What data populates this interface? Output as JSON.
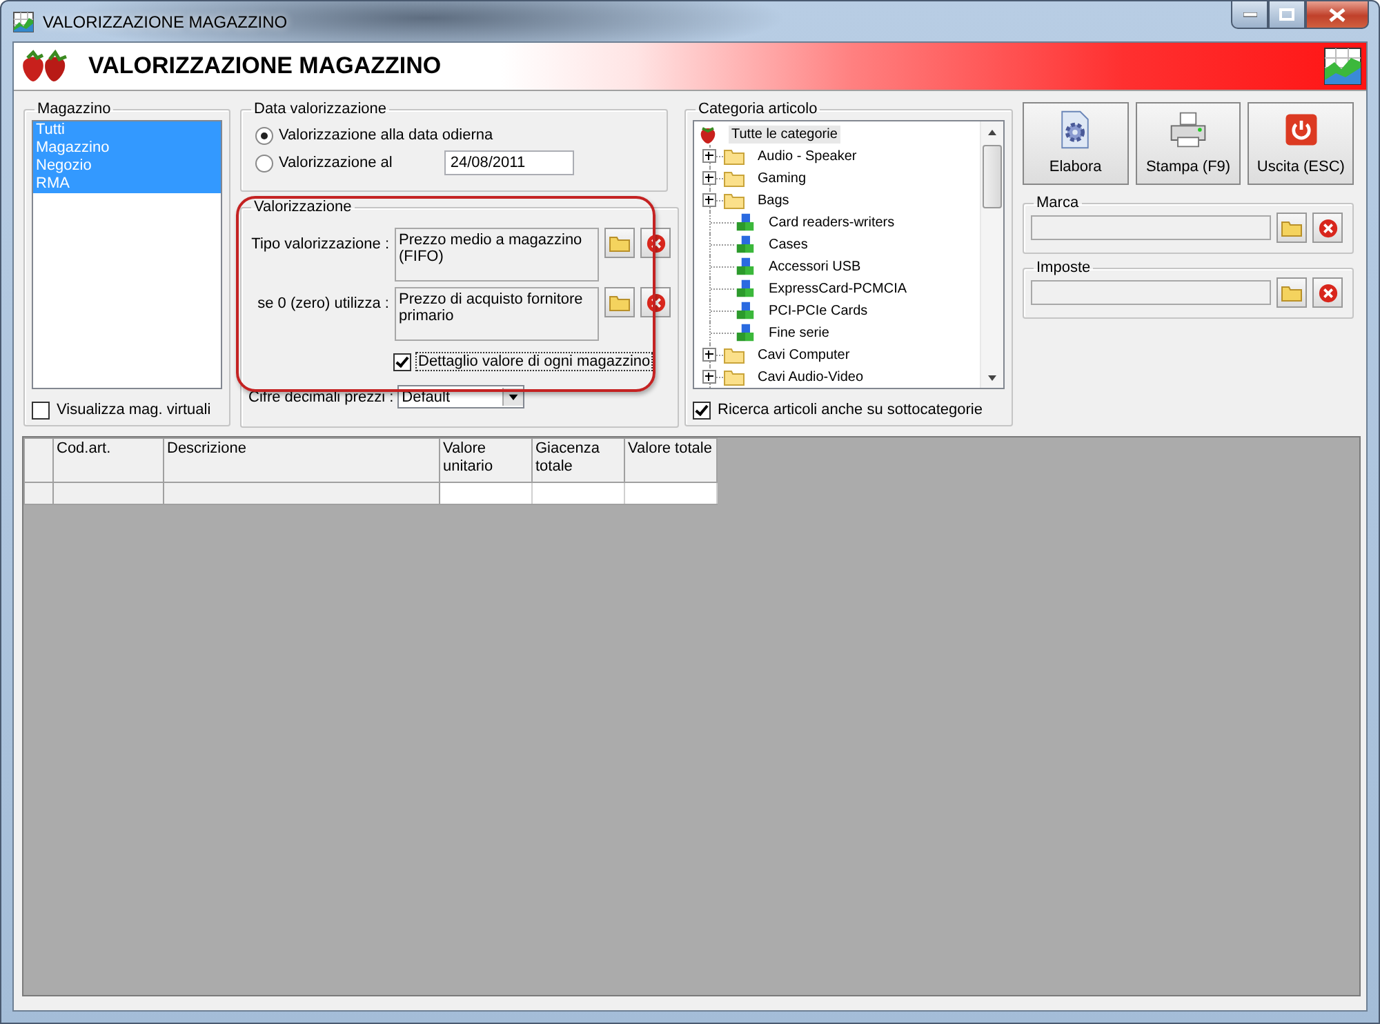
{
  "window": {
    "title": "VALORIZZAZIONE MAGAZZINO"
  },
  "header": {
    "title": "VALORIZZAZIONE MAGAZZINO"
  },
  "magazzino": {
    "title": "Magazzino",
    "items": [
      {
        "label": "Tutti",
        "selected": true
      },
      {
        "label": "Magazzino",
        "selected": true
      },
      {
        "label": "Negozio",
        "selected": true
      },
      {
        "label": "RMA",
        "selected": true
      }
    ],
    "virtual": {
      "label": "Visualizza mag. virtuali",
      "checked": false
    }
  },
  "data_valorizzazione": {
    "title": "Data valorizzazione",
    "options": [
      {
        "label": "Valorizzazione alla data odierna",
        "selected": true
      },
      {
        "label": "Valorizzazione al",
        "selected": false,
        "date": "24/08/2011"
      }
    ]
  },
  "valorizzazione": {
    "title": "Valorizzazione",
    "highlighted": true,
    "fields": [
      {
        "label": "Tipo valorizzazione :",
        "value": "Prezzo medio a magazzino (FIFO)"
      },
      {
        "label": "se 0 (zero) utilizza :",
        "value": "Prezzo di acquisto fornitore primario"
      }
    ],
    "detail": {
      "label": "Dettaglio valore di ogni magazzino",
      "checked": true
    },
    "decimals": {
      "label": "Cifre decimali prezzi :",
      "value": "Default"
    }
  },
  "categoria": {
    "title": "Categoria articolo",
    "tree": {
      "label": "Tutte le categorie",
      "selected": true,
      "children": [
        {
          "label": "Audio - Speaker",
          "kind": "folder",
          "expanded": false,
          "selected": false
        },
        {
          "label": "Gaming",
          "kind": "folder",
          "expanded": false,
          "selected": false
        },
        {
          "label": "Bags",
          "kind": "folder",
          "expanded": false,
          "selected": false
        },
        {
          "label": "Card readers-writers",
          "kind": "category",
          "selected": false
        },
        {
          "label": "Cases",
          "kind": "category",
          "selected": false
        },
        {
          "label": "Accessori USB",
          "kind": "category",
          "selected": false
        },
        {
          "label": "ExpressCard-PCMCIA",
          "kind": "category",
          "selected": false
        },
        {
          "label": "PCI-PCIe Cards",
          "kind": "category",
          "selected": false
        },
        {
          "label": "Fine serie",
          "kind": "category",
          "selected": false
        },
        {
          "label": "Cavi Computer",
          "kind": "folder",
          "expanded": false,
          "selected": false
        },
        {
          "label": "Cavi Audio-Video",
          "kind": "folder",
          "expanded": false,
          "selected": false
        }
      ]
    },
    "subcategories": {
      "label": "Ricerca articoli anche su sottocategorie",
      "checked": true
    }
  },
  "buttons": [
    {
      "label": "Elabora",
      "kind": "process"
    },
    {
      "label": "Stampa (F9)",
      "kind": "print"
    },
    {
      "label": "Uscita (ESC)",
      "kind": "exit"
    }
  ],
  "filters": [
    {
      "title": "Marca"
    },
    {
      "title": "Imposte"
    }
  ],
  "table": {
    "columns": [
      "Cod.art.",
      "Descrizione",
      "Valore unitario",
      "Giacenza totale",
      "Valore totale"
    ]
  }
}
